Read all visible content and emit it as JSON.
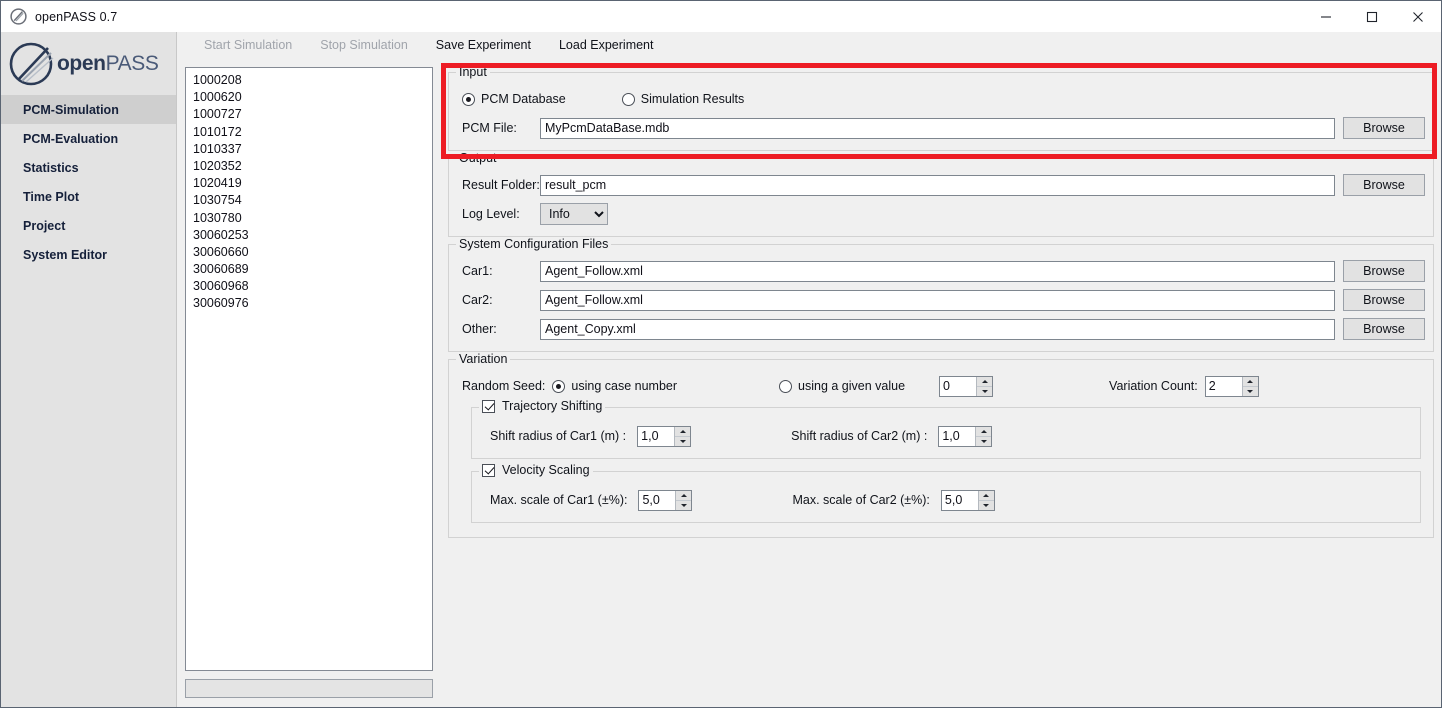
{
  "window": {
    "title": "openPASS 0.7",
    "app_icon": "openpass-logo-icon",
    "minimize": "–",
    "maximize": "□",
    "close": "✕"
  },
  "sidebar": {
    "logo_bold": "open",
    "logo_light": "PASS",
    "items": [
      {
        "label": "PCM-Simulation",
        "active": true
      },
      {
        "label": "PCM-Evaluation",
        "active": false
      },
      {
        "label": "Statistics",
        "active": false
      },
      {
        "label": "Time Plot",
        "active": false
      },
      {
        "label": "Project",
        "active": false
      },
      {
        "label": "System Editor",
        "active": false
      }
    ]
  },
  "menubar": {
    "items": [
      {
        "label": "Start Simulation",
        "disabled": true
      },
      {
        "label": "Stop Simulation",
        "disabled": true
      },
      {
        "label": "Save Experiment",
        "disabled": false
      },
      {
        "label": "Load Experiment",
        "disabled": false
      }
    ]
  },
  "case_list": {
    "items": [
      "1000208",
      "1000620",
      "1000727",
      "1010172",
      "1010337",
      "1020352",
      "1020419",
      "1030754",
      "1030780",
      "30060253",
      "30060660",
      "30060689",
      "30060968",
      "30060976"
    ]
  },
  "progress": {
    "value": ""
  },
  "input_group": {
    "legend": "Input",
    "radio_pcm_database": "PCM Database",
    "radio_simulation_results": "Simulation Results",
    "pcm_file_label": "PCM File:",
    "pcm_file_value": "MyPcmDataBase.mdb",
    "browse_label": "Browse",
    "highlight_color": "#ed1c24"
  },
  "output_group": {
    "legend": "Output",
    "result_folder_label": "Result Folder:",
    "result_folder_value": "result_pcm",
    "log_level_label": "Log Level:",
    "log_level_value": "Info",
    "log_level_options": [
      "Info"
    ],
    "browse_label": "Browse"
  },
  "sysconfig_group": {
    "legend": "System Configuration Files",
    "rows": [
      {
        "label": "Car1:",
        "value": "Agent_Follow.xml",
        "browse": "Browse"
      },
      {
        "label": "Car2:",
        "value": "Agent_Follow.xml",
        "browse": "Browse"
      },
      {
        "label": "Other:",
        "value": "Agent_Copy.xml",
        "browse": "Browse"
      }
    ]
  },
  "variation_group": {
    "legend": "Variation",
    "random_seed_label": "Random Seed:",
    "radio_case_number": "using case number",
    "radio_given_value": "using a given value",
    "given_value": "0",
    "variation_count_label": "Variation Count:",
    "variation_count": "2",
    "trajectory": {
      "legend": "Trajectory Shifting",
      "checked": true,
      "car1_label": "Shift radius of Car1 (m) :",
      "car1_value": "1,0",
      "car2_label": "Shift radius of Car2 (m) :",
      "car2_value": "1,0"
    },
    "velocity": {
      "legend": "Velocity Scaling",
      "checked": true,
      "car1_label": "Max. scale of Car1 (±%):",
      "car1_value": "5,0",
      "car2_label": "Max. scale of Car2 (±%):",
      "car2_value": "5,0"
    }
  }
}
